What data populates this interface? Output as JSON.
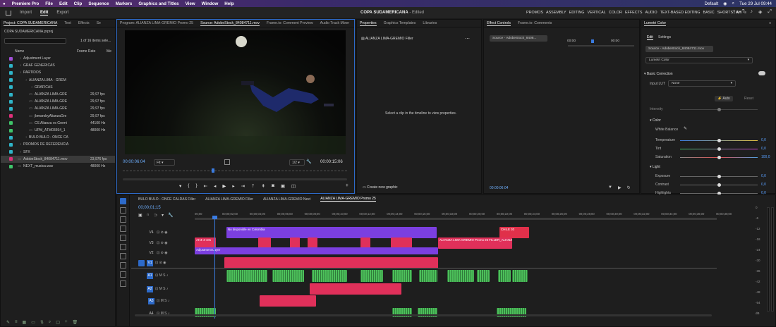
{
  "menubar": {
    "apple": "",
    "app": "Premiere Pro",
    "items": [
      "File",
      "Edit",
      "Clip",
      "Sequence",
      "Markers",
      "Graphics and Titles",
      "View",
      "Window",
      "Help"
    ],
    "status_default": "Default",
    "clock": "Tue 29 Jul  09:44"
  },
  "appbar": {
    "tabs": [
      "Import",
      "Edit",
      "Export"
    ],
    "active_tab": "Edit",
    "project_title": "COPA SUDAMERICANA",
    "edited": "- Edited",
    "workspaces": [
      "PROMOS",
      "ASSEMBLY",
      "EDITING",
      "VERTICAL",
      "COLOR",
      "EFFECTS",
      "AUDIO",
      "TEXT-BASED EDITING",
      "BASIC",
      "SHORTS",
      "AH"
    ],
    "active_workspace": "AH"
  },
  "project": {
    "tabs": [
      "Project: COPA SUDAMERICANA",
      "Text",
      "Effects",
      "Se"
    ],
    "file": "COPA SUDAMERICANA.prproj",
    "count": "1 of 16 items sele...",
    "col_name": "Name",
    "col_fps": "Frame Rate",
    "col_media": "Me",
    "items": [
      {
        "name": "Adjustment Layer",
        "fps": "",
        "color": "#a24fd8",
        "indent": 0
      },
      {
        "name": "GRAF GENERICAS",
        "fps": "",
        "color": "#2fb5c9",
        "indent": 0
      },
      {
        "name": "PARTIDOS",
        "fps": "",
        "color": "#2fb5c9",
        "indent": 0
      },
      {
        "name": "ALIANZA LIMA - GREM",
        "fps": "",
        "color": "#2fb5c9",
        "indent": 1
      },
      {
        "name": "GRAFICAS",
        "fps": "",
        "color": "#2fb5c9",
        "indent": 2
      },
      {
        "name": "ALIANZA LIMA-GRE",
        "fps": "29,97 fps",
        "color": "#2fb5c9",
        "indent": 2
      },
      {
        "name": "ALIANZA LIMA-GRE",
        "fps": "29,97 fps",
        "color": "#2fb5c9",
        "indent": 2
      },
      {
        "name": "ALIANZA LIMA-GRE",
        "fps": "29,97 fps",
        "color": "#2fb5c9",
        "indent": 2
      },
      {
        "name": "jbmarobyAlianzaGre",
        "fps": "29,97 fps",
        "color": "#e0307a",
        "indent": 2
      },
      {
        "name": "CS Alianza vs Gremi",
        "fps": "44100 Hz",
        "color": "#3fc56a",
        "indent": 2
      },
      {
        "name": "UPM_ATM03594_1",
        "fps": "48000 Hz",
        "color": "#3fc56a",
        "indent": 2
      },
      {
        "name": "BULO BULO - ONCE CA",
        "fps": "",
        "color": "#2fb5c9",
        "indent": 1
      },
      {
        "name": "PROMOS DE REFERENCIA",
        "fps": "",
        "color": "#2fb5c9",
        "indent": 0
      },
      {
        "name": "SFX",
        "fps": "",
        "color": "#2fb5c9",
        "indent": 0
      },
      {
        "name": "AdobeStock_84084711.mov",
        "fps": "23,976 fps",
        "color": "#e0307a",
        "indent": 0,
        "selected": true
      },
      {
        "name": "NEXT_musica.wav",
        "fps": "48000 Hz",
        "color": "#3fc56a",
        "indent": 0
      }
    ]
  },
  "program": {
    "tabs": [
      "Program: ALIANZA LIMA-GREMIO Promo 25",
      "Source: AdobeStock_84084711.mov",
      "Frame.io: Comment Preview",
      "Audio Track Mixer"
    ],
    "timecode": "00:00:06:04",
    "fit": "Fit",
    "scale": "1/2",
    "duration": "00:00:15:06"
  },
  "properties": {
    "tabs": [
      "Properties",
      "Graphics Templates",
      "Libraries"
    ],
    "clip": "ALIANZA LIMA-GREMIO Filler",
    "message": "Select a clip in the timeline to view properties.",
    "create": "Create new graphic"
  },
  "effect_controls": {
    "tabs": [
      "Effect Controls",
      "Frame.io: Comments"
    ],
    "source": "Source - AdobeStock_8408...",
    "tc1": "00:00",
    "tc2": "00:00",
    "timecode": "00:00:06:04"
  },
  "lumetri": {
    "tab": "Lumetri Color",
    "subtabs": [
      "Edit",
      "Settings"
    ],
    "source": "Source - AdobeStock_84084711.mov",
    "preset": "Lumetri Color",
    "section": "Basic Correction",
    "input_lut_label": "Input LUT",
    "input_lut": "None",
    "auto": "Auto",
    "reset": "Reset",
    "intensity": "Intensity",
    "color_label": "Color",
    "white_balance": "White Balance",
    "color_rows": [
      {
        "name": "Temperature",
        "value": "0,0",
        "pos": 0.5
      },
      {
        "name": "Tint",
        "value": "0,0",
        "pos": 0.5
      },
      {
        "name": "Saturation",
        "value": "100,0",
        "pos": 0.5
      }
    ],
    "light_label": "Light",
    "light_rows": [
      {
        "name": "Exposure",
        "value": "0,0",
        "pos": 0.5
      },
      {
        "name": "Contrast",
        "value": "0,0",
        "pos": 0.5
      },
      {
        "name": "Highlights",
        "value": "0,0",
        "pos": 0.5
      }
    ]
  },
  "timeline": {
    "tabs": [
      "BULO BULO - ONCE CALDAS Filler",
      "ALIANZA LIMA-GREMIO Filler",
      "ALIANZA LIMA-GREMIO Next",
      "ALIANZA LIMA-GREMIO Promo 25"
    ],
    "active_tab": 3,
    "timecode": "00;00;01;15",
    "ruler": [
      "00;00",
      "00;00;02;00",
      "00;00;04;00",
      "00;00;06;00",
      "00;00;08;00",
      "00;00;10;00",
      "00;00;12;00",
      "00;00;14;00",
      "00;00;16;00",
      "00;00;18;00",
      "00;00;20;00",
      "00;00;22;00",
      "00;00;24;00",
      "00;00;26;00",
      "00;00;28;00",
      "00;00;30;00",
      "00;00;32;00",
      "00;00;34;00",
      "00;00;36;00",
      "00;00;38;00"
    ],
    "tracks": [
      "V4",
      "V3",
      "V2",
      "V1",
      "A1",
      "A2",
      "A3",
      "A4"
    ],
    "clip_v4": "No disponible en Colombia",
    "clip_v2": "Adjustment Layer",
    "clip_v3a": "AH4-4-101",
    "clip_v3b": "ALIANZA LIMA-GREMIO Promo 25 FILLER_ALIANZA LIMA...",
    "clip_red": "CHILE 30",
    "meter_labels": [
      "0",
      "-6",
      "-12",
      "-18",
      "-24",
      "-30",
      "-36",
      "-42",
      "-48",
      "-54",
      "dB"
    ]
  }
}
